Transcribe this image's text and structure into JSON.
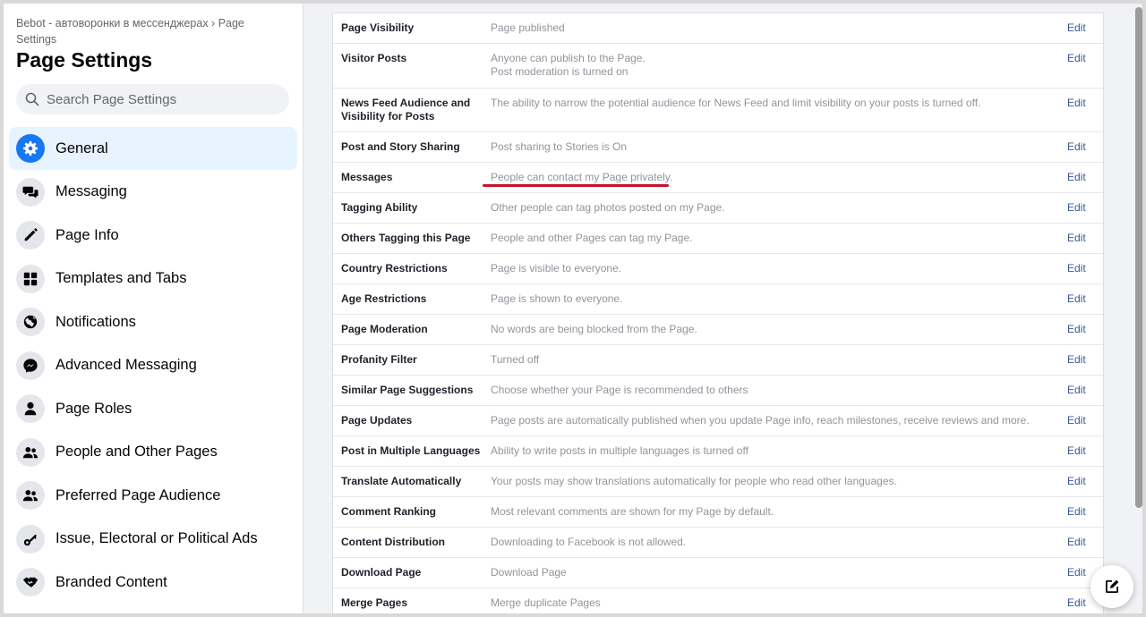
{
  "sidebar": {
    "breadcrumb": "Bebot - автоворонки в мессенджерах › Page Settings",
    "title": "Page Settings",
    "search_placeholder": "Search Page Settings",
    "items": [
      {
        "label": "General",
        "icon": "gear-icon",
        "active": true
      },
      {
        "label": "Messaging",
        "icon": "chat-bubbles-icon"
      },
      {
        "label": "Page Info",
        "icon": "pencil-icon"
      },
      {
        "label": "Templates and Tabs",
        "icon": "grid-icon"
      },
      {
        "label": "Notifications",
        "icon": "globe-icon"
      },
      {
        "label": "Advanced Messaging",
        "icon": "messenger-icon"
      },
      {
        "label": "Page Roles",
        "icon": "person-icon"
      },
      {
        "label": "People and Other Pages",
        "icon": "people-icon"
      },
      {
        "label": "Preferred Page Audience",
        "icon": "people-icon"
      },
      {
        "label": "Issue, Electoral or Political Ads",
        "icon": "key-icon"
      },
      {
        "label": "Branded Content",
        "icon": "handshake-icon"
      }
    ]
  },
  "settings": {
    "edit_label": "Edit",
    "rows": [
      {
        "label": "Page Visibility",
        "value": "Page published"
      },
      {
        "label": "Visitor Posts",
        "value": "Anyone can publish to the Page.",
        "value2": "Post moderation is turned on"
      },
      {
        "label": "News Feed Audience and Visibility for Posts",
        "value": "The ability to narrow the potential audience for News Feed and limit visibility on your posts is turned off."
      },
      {
        "label": "Post and Story Sharing",
        "value": "Post sharing to Stories is On"
      },
      {
        "label": "Messages",
        "value": "People can contact my Page privately."
      },
      {
        "label": "Tagging Ability",
        "value": "Other people can tag photos posted on my Page."
      },
      {
        "label": "Others Tagging this Page",
        "value": "People and other Pages can tag my Page."
      },
      {
        "label": "Country Restrictions",
        "value": "Page is visible to everyone."
      },
      {
        "label": "Age Restrictions",
        "value": "Page is shown to everyone."
      },
      {
        "label": "Page Moderation",
        "value": "No words are being blocked from the Page."
      },
      {
        "label": "Profanity Filter",
        "value": "Turned off"
      },
      {
        "label": "Similar Page Suggestions",
        "value": "Choose whether your Page is recommended to others"
      },
      {
        "label": "Page Updates",
        "value": "Page posts are automatically published when you update Page info, reach milestones, receive reviews and more."
      },
      {
        "label": "Post in Multiple Languages",
        "value": "Ability to write posts in multiple languages is turned off"
      },
      {
        "label": "Translate Automatically",
        "value": "Your posts may show translations automatically for people who read other languages."
      },
      {
        "label": "Comment Ranking",
        "value": "Most relevant comments are shown for my Page by default."
      },
      {
        "label": "Content Distribution",
        "value": "Downloading to Facebook is not allowed."
      },
      {
        "label": "Download Page",
        "value": "Download Page"
      },
      {
        "label": "Merge Pages",
        "value": "Merge duplicate Pages"
      }
    ]
  },
  "colors": {
    "accent": "#1877f2",
    "link": "#385898",
    "highlight_underline": "#c8102e"
  }
}
